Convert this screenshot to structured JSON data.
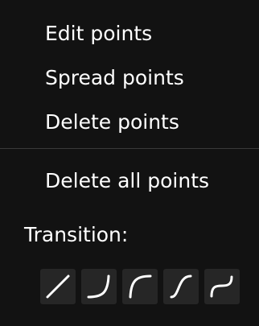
{
  "menu": {
    "items": [
      {
        "label": "Edit points"
      },
      {
        "label": "Spread points"
      },
      {
        "label": "Delete points"
      },
      {
        "label": "Delete all points"
      }
    ],
    "transition_label": "Transition:",
    "transition_options": [
      {
        "icon": "linear-curve-icon"
      },
      {
        "icon": "ease-in-curve-icon"
      },
      {
        "icon": "ease-out-curve-icon"
      },
      {
        "icon": "ease-in-out-curve-icon"
      },
      {
        "icon": "s-curve-icon"
      }
    ]
  },
  "colors": {
    "background": "#121212",
    "text": "#ffffff",
    "button_background": "#262626",
    "divider": "#3a3a3a"
  }
}
